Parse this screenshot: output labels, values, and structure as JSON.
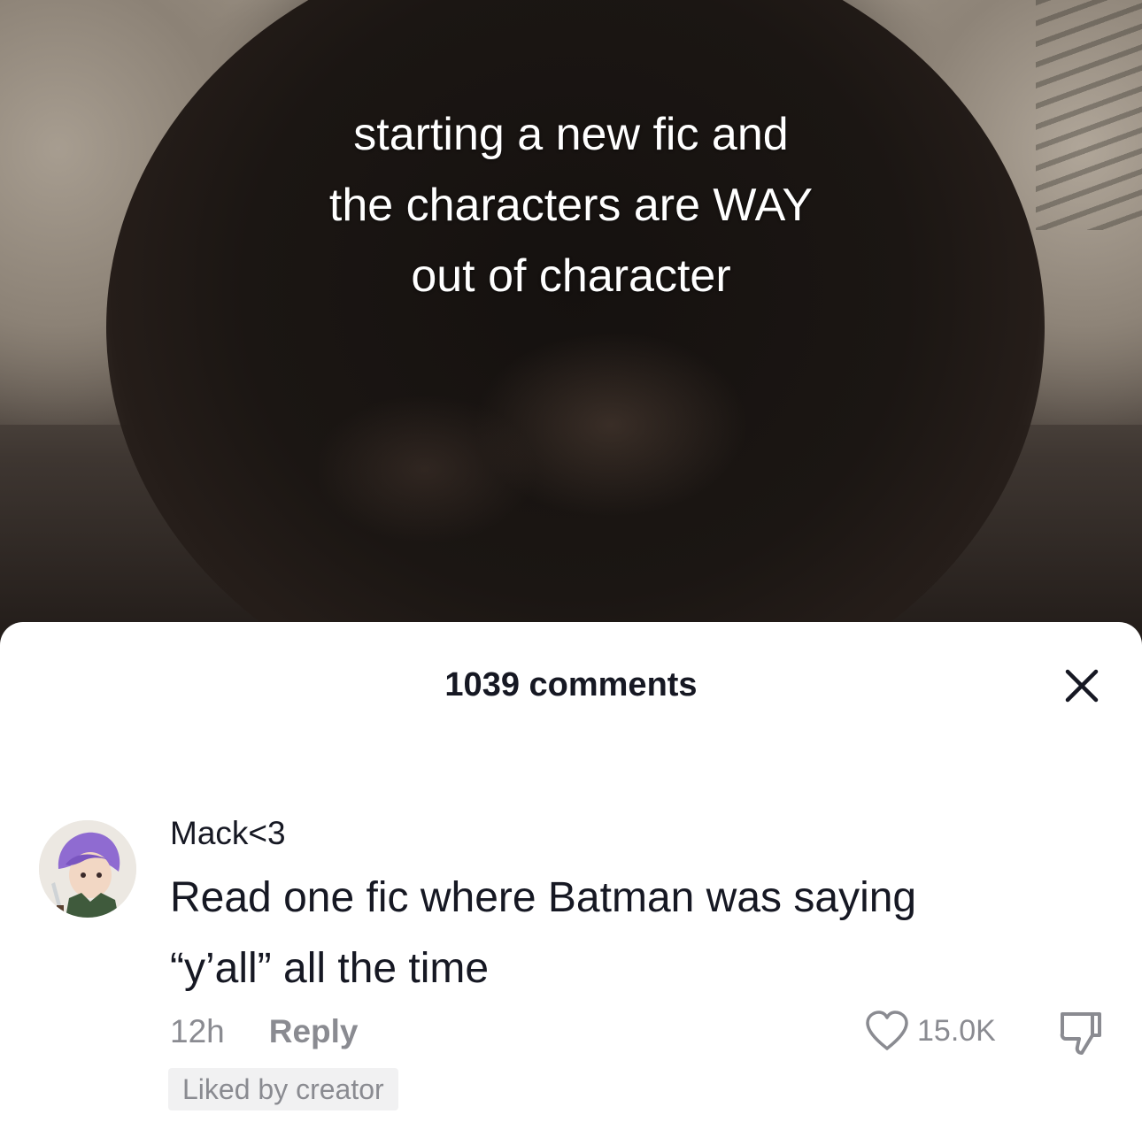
{
  "video": {
    "caption_lines": [
      "starting a new fic and",
      "the characters are WAY",
      "out of character"
    ]
  },
  "comments_sheet": {
    "title": "1039 comments",
    "close_icon": "close-icon",
    "comment": {
      "username": "Mack<3",
      "text_lines": [
        "Read one fic where Batman was saying",
        "“y’all” all the time"
      ],
      "time": "12h",
      "reply_label": "Reply",
      "like_icon": "heart-outline-icon",
      "like_count": "15.0K",
      "dislike_icon": "thumbs-down-icon",
      "liked_by_creator": "Liked by creator"
    }
  },
  "colors": {
    "text_primary": "#161823",
    "text_secondary": "#8a8b91",
    "badge_bg": "#f1f1f2"
  }
}
